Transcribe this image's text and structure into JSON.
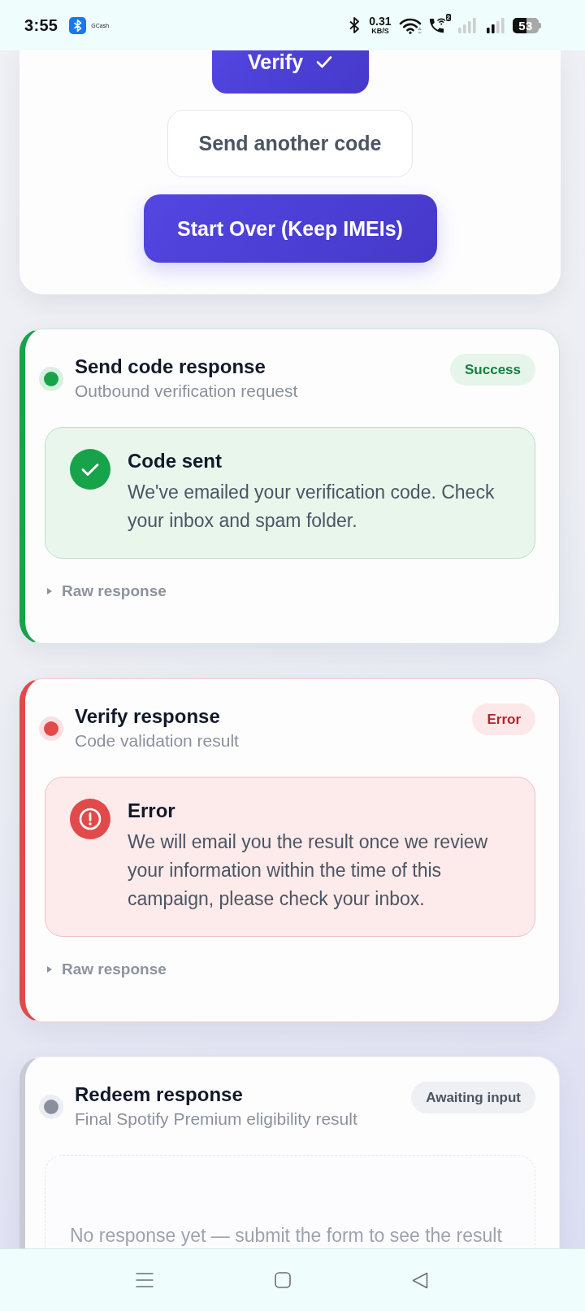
{
  "status_bar": {
    "time": "3:55",
    "app_label": "GCash",
    "speed_value": "0.31",
    "speed_unit": "KB/S",
    "sim_number": "2",
    "battery": "53"
  },
  "action_card": {
    "buttons": [
      {
        "kind": "confirm",
        "label": "Verify"
      },
      {
        "kind": "outline",
        "label": "Send another code"
      },
      {
        "kind": "primary",
        "label": "Start Over (Keep IMEIs)"
      }
    ]
  },
  "responses": [
    {
      "kind": "success",
      "title": "Send code response",
      "subtitle": "Outbound verification request",
      "badge": "Success",
      "result": {
        "title": "Code sent",
        "message": "We've emailed your verification code. Check your inbox and spam folder."
      },
      "raw_toggle": {
        "label": "Raw response",
        "expanded": false
      }
    },
    {
      "kind": "error",
      "title": "Verify response",
      "subtitle": "Code validation result",
      "badge": "Error",
      "result": {
        "title": "Error",
        "message": "We will email you the result once we review your information within the time of this campaign, please check your inbox."
      },
      "raw_toggle": {
        "label": "Raw response",
        "expanded": false
      }
    },
    {
      "kind": "pending",
      "title": "Redeem response",
      "subtitle": "Final Spotify Premium eligibility result",
      "badge": "Awaiting input",
      "empty_message": "No response yet — submit the form to see the result"
    }
  ]
}
